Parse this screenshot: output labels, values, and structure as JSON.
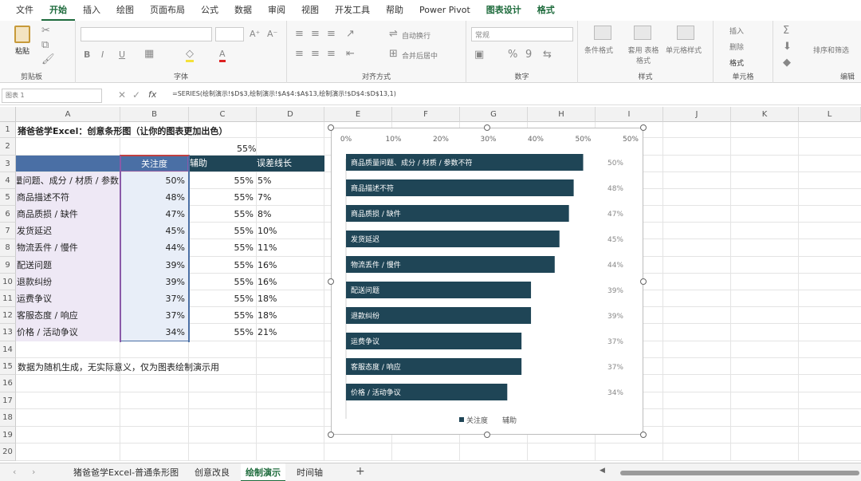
{
  "menu_tabs": [
    "文件",
    "开始",
    "插入",
    "绘图",
    "页面布局",
    "公式",
    "数据",
    "审阅",
    "视图",
    "开发工具",
    "帮助",
    "Power Pivot",
    "图表设计",
    "格式"
  ],
  "ribbon": {
    "paste_label": "粘贴",
    "groups": [
      "剪贴板",
      "字体",
      "对齐方式",
      "数字",
      "样式",
      "单元格",
      "编辑"
    ],
    "bold": "B",
    "italic": "I",
    "underline": "U",
    "font_grow": "A⁺",
    "font_shrink": "A⁻",
    "wrap_text": "自动换行",
    "merge_center": "合并后居中",
    "number_format": "常规",
    "percent": "%",
    "comma": "9",
    "cond_format": "条件格式",
    "table_format": "套用\n表格格式",
    "cell_style": "单元格样式",
    "insert": "插入",
    "delete": "删除",
    "format": "格式",
    "sort_filter": "排序和筛选",
    "sum": "Σ"
  },
  "formula_bar": {
    "name_box": "图表 1",
    "fx": "fx",
    "formula": "=SERIES(绘制演示!$D$3,绘制演示!$A$4:$A$13,绘制演示!$D$4:$D$13,1)"
  },
  "columns": [
    "A",
    "B",
    "C",
    "D",
    "E",
    "F",
    "G",
    "H",
    "I",
    "J",
    "K",
    "L"
  ],
  "rows": [
    "1",
    "2",
    "3",
    "4",
    "5",
    "6",
    "7",
    "8",
    "9",
    "10",
    "11",
    "12",
    "13",
    "14",
    "15",
    "16",
    "17",
    "18",
    "19",
    "20"
  ],
  "sheet": {
    "title": "猪爸爸学Excel：创意条形图（让你的图表更加出色）",
    "c2": "55%",
    "headers": {
      "b": "关注度",
      "c": "辅助",
      "d": "误差线长"
    },
    "a_col": [
      "商品质量问题、成分 / 材质 / 参数",
      "商品描述不符",
      "商品质损 / 缺件",
      "发货延迟",
      "物流丢件 / 慢件",
      "配送问题",
      "退款纠纷",
      "运费争议",
      "客服态度 / 响应",
      "价格 / 活动争议"
    ],
    "b_col": [
      "50%",
      "48%",
      "47%",
      "45%",
      "44%",
      "39%",
      "39%",
      "37%",
      "37%",
      "34%"
    ],
    "c_col": [
      "55%",
      "55%",
      "55%",
      "55%",
      "55%",
      "55%",
      "55%",
      "55%",
      "55%",
      "55%"
    ],
    "d_col": [
      "5%",
      "7%",
      "8%",
      "10%",
      "11%",
      "16%",
      "16%",
      "18%",
      "18%",
      "21%"
    ],
    "note": "数据为随机生成，无实际意义，仅为图表绘制演示用"
  },
  "chart_data": {
    "type": "bar",
    "orientation": "horizontal",
    "categories": [
      "商品质量问题、成分 / 材质 / 参数不符",
      "商品描述不符",
      "商品质损 / 缺件",
      "发货延迟",
      "物流丢件 / 慢件",
      "配送问题",
      "退款纠纷",
      "运费争议",
      "客服态度 / 响应",
      "价格 / 活动争议"
    ],
    "series": [
      {
        "name": "关注度",
        "values": [
          50,
          48,
          47,
          45,
          44,
          39,
          39,
          37,
          37,
          34
        ]
      }
    ],
    "data_labels": [
      "50%",
      "48%",
      "47%",
      "45%",
      "44%",
      "39%",
      "39%",
      "37%",
      "37%",
      "34%"
    ],
    "x_ticks": [
      "0%",
      "10%",
      "20%",
      "30%",
      "40%",
      "50%",
      "50%"
    ],
    "xlim": [
      0,
      60
    ],
    "legend": [
      "关注度",
      "辅助"
    ],
    "legend_position": "bottom",
    "bar_color": "#1f4556"
  },
  "sheet_tabs": [
    "猪爸爸学Excel-普通条形图",
    "创意改良",
    "绘制演示",
    "时间轴"
  ],
  "active_sheet": "绘制演示",
  "colors": {
    "header_fill": "#1f4556",
    "selected_fill": "#4a6fa5",
    "row_fill": "#eee8f5",
    "accent": "#1e6b3c"
  }
}
